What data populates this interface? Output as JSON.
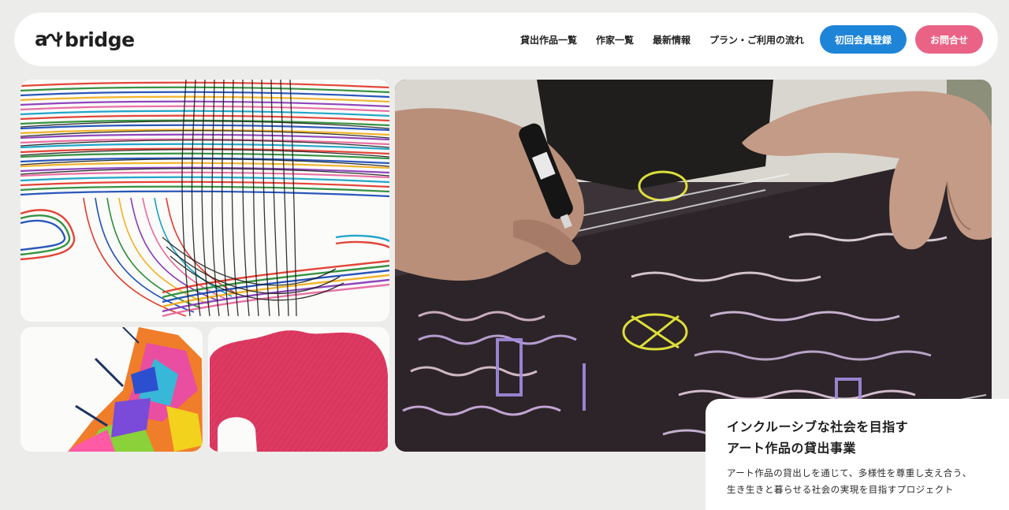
{
  "brand": {
    "logo_text": "bridge",
    "logo_mark": "ar~t"
  },
  "nav": {
    "items": [
      {
        "label": "貸出作品一覧"
      },
      {
        "label": "作家一覧"
      },
      {
        "label": "最新情報"
      },
      {
        "label": "プラン・ご利用の流れ"
      }
    ]
  },
  "actions": {
    "register_label": "初回会員登録",
    "contact_label": "お問合せ"
  },
  "hero": {
    "headline_line1": "インクルーシブな社会を目指す",
    "headline_line2": "アート作品の貸出事業",
    "description_line1": "アート作品の貸出しを通じて、多様性を尊重し支え合う、",
    "description_line2": "生き生きと暮らせる社会の実現を目指すプロジェクト"
  },
  "colors": {
    "accent_blue": "#1e84d8",
    "accent_pink": "#ea6386",
    "page_bg": "#ececea"
  }
}
